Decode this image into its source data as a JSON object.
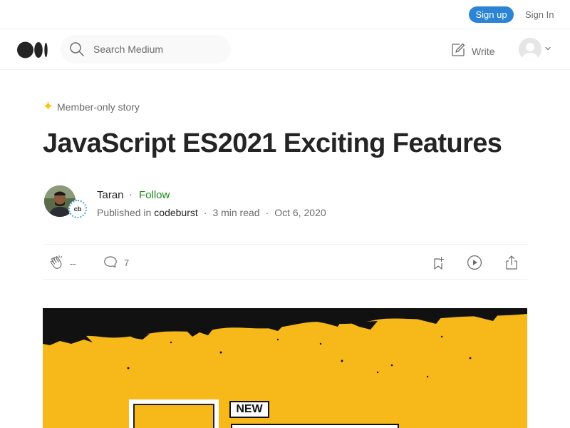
{
  "topbar": {
    "signup_label": "Sign up",
    "signin_label": "Sign In"
  },
  "header": {
    "logo_icon": "medium-logo-icon",
    "search": {
      "placeholder": "Search Medium",
      "value": ""
    },
    "write_label": "Write",
    "avatar_icon": "user-avatar-icon"
  },
  "article": {
    "member_label": "Member-only story",
    "title": "JavaScript ES2021 Exciting Features",
    "author": {
      "name": "Taran",
      "follow_label": "Follow",
      "badge_text": "cb",
      "published_prefix": "Published in",
      "publication": "codeburst",
      "read_time": "3 min read",
      "date": "Oct 6, 2020"
    },
    "actions": {
      "clap_count": "--",
      "response_count": "7"
    },
    "hero": {
      "tag_text": "NEW"
    }
  },
  "colors": {
    "accent_blue": "#2b84d4",
    "follow_green": "#1a8917",
    "member_star": "#ffc017",
    "hero_yellow": "#f7b81a"
  }
}
